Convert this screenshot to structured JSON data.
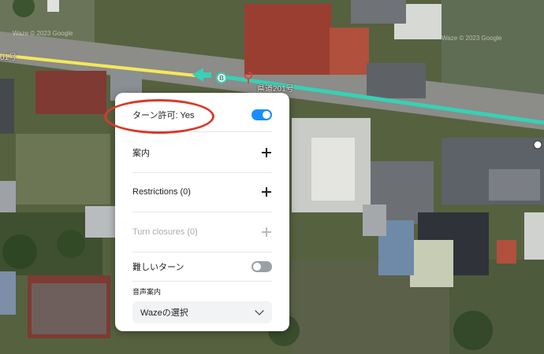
{
  "map": {
    "road_label_left": "01号",
    "road_label_right": "県道201号",
    "watermark_1": "Waze © 2023 Google",
    "watermark_2": "Waze © 2023 Google",
    "segment_marker_label": "B",
    "colors": {
      "road_yellow": "#f5e85a",
      "road_teal": "#36d1b6",
      "marker": "#36d1b6",
      "annotation": "#d93a2b"
    }
  },
  "panel": {
    "turn_allowed_label": "ターン許可: Yes",
    "turn_allowed_on": true,
    "guidance_label": "案内",
    "restrictions_label": "Restrictions (0)",
    "turn_closures_label": "Turn closures (0)",
    "difficult_turn_label": "難しいターン",
    "difficult_turn_on": false,
    "voice_guidance_label": "音声案内",
    "voice_select_value": "Wazeの選択"
  }
}
